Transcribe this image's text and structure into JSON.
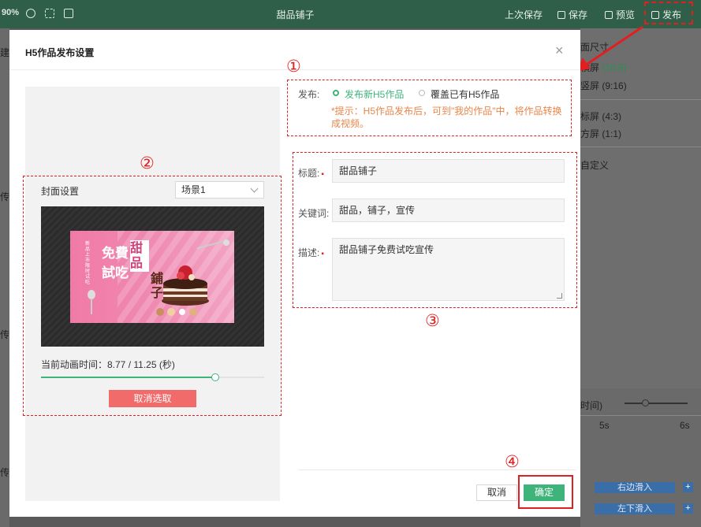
{
  "topbar": {
    "zoom": "90%",
    "doc_title": "甜品铺子",
    "last_save": "上次保存",
    "save": "保存",
    "preview": "预览",
    "publish": "发布"
  },
  "background_panel": {
    "section_title": "面尺寸",
    "ratios": [
      {
        "label": "横屏",
        "value": "(16:9)"
      },
      {
        "label": "竖屏",
        "value": "(9:16)"
      },
      {
        "label": "标屏",
        "value": "(4:3)"
      },
      {
        "label": "方屏",
        "value": "(1:1)"
      }
    ],
    "custom": "自定义",
    "timeline_label": "时间)",
    "tick_5s": "5s",
    "tick_6s": "6s",
    "btn_right_out": "右边滑入",
    "btn_bottom_out": "左下滑入",
    "left_edge_texts": [
      "建",
      "传",
      "传",
      "传"
    ]
  },
  "modal": {
    "title": "H5作品发布设置",
    "close": "×",
    "publish_label": "发布:",
    "option_new": "发布新H5作品",
    "option_overwrite": "覆盖已有H5作品",
    "tip": "*提示：H5作品发布后，可到\"我的作品\"中，将作品转换成视频。",
    "cover": {
      "label": "封面设置",
      "scene": "场景1",
      "time_label": "当前动画时间：8.77 / 11.25 (秒)",
      "progress": 0.78,
      "unselect": "取消选取"
    },
    "poster": {
      "line_a": "免費",
      "line_b": "試吃",
      "line_c": "甜品",
      "line_d": "鋪子",
      "small_text": "新品上市限时试吃"
    },
    "fields": {
      "title_label": "标题:",
      "title_value": "甜品铺子",
      "keywords_label": "关键词:",
      "keywords_value": "甜品，铺子，宣传",
      "desc_label": "描述:",
      "desc_value": "甜品铺子免费试吃宣传"
    },
    "cancel": "取消",
    "confirm": "确定"
  },
  "annotations": {
    "n1": "①",
    "n2": "②",
    "n3": "③",
    "n4": "④"
  },
  "colors": {
    "accent_green": "#3fb47a",
    "annotation_red": "#e02020",
    "tip_orange": "#e8864a",
    "unselect_red": "#f26b6b"
  }
}
